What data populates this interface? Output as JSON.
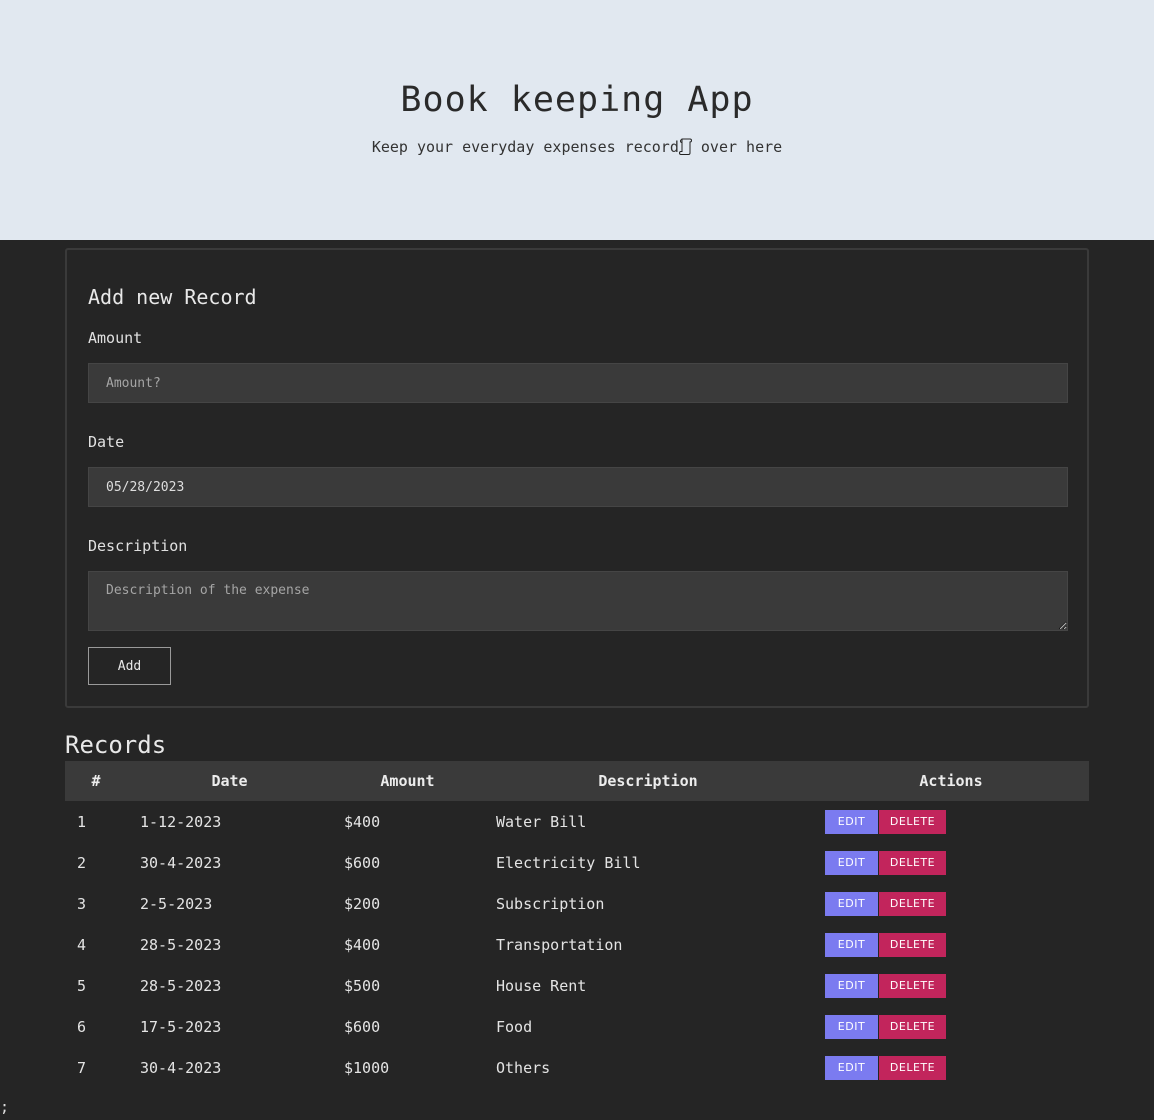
{
  "header": {
    "title": "Book keeping App",
    "subtitle_before": "Keep your everyday expenses record",
    "subtitle_icon": "scroll-icon",
    "subtitle_after": " over here"
  },
  "form": {
    "heading": "Add new Record",
    "amount_label": "Amount",
    "amount_placeholder": "Amount?",
    "amount_value": "",
    "date_label": "Date",
    "date_value": "05/28/2023",
    "description_label": "Description",
    "description_placeholder": "Description of the expense",
    "description_value": "",
    "add_label": "Add"
  },
  "records": {
    "title": "Records",
    "columns": [
      "#",
      "Date",
      "Amount",
      "Description",
      "Actions"
    ],
    "edit_label": "EDIT",
    "delete_label": "DELETE",
    "rows": [
      {
        "num": "1",
        "date": "1-12-2023",
        "amount": "$400",
        "description": "Water Bill"
      },
      {
        "num": "2",
        "date": "30-4-2023",
        "amount": "$600",
        "description": "Electricity Bill"
      },
      {
        "num": "3",
        "date": "2-5-2023",
        "amount": "$200",
        "description": "Subscription"
      },
      {
        "num": "4",
        "date": "28-5-2023",
        "amount": "$400",
        "description": "Transportation"
      },
      {
        "num": "5",
        "date": "28-5-2023",
        "amount": "$500",
        "description": "House Rent"
      },
      {
        "num": "6",
        "date": "17-5-2023",
        "amount": "$600",
        "description": "Food"
      },
      {
        "num": "7",
        "date": "30-4-2023",
        "amount": "$1000",
        "description": "Others"
      }
    ]
  },
  "footer_stray_text": ";",
  "colors": {
    "header_bg": "#e1e8f0",
    "page_bg": "#252525",
    "edit_button": "#7b7bf0",
    "delete_button": "#c2255c"
  }
}
